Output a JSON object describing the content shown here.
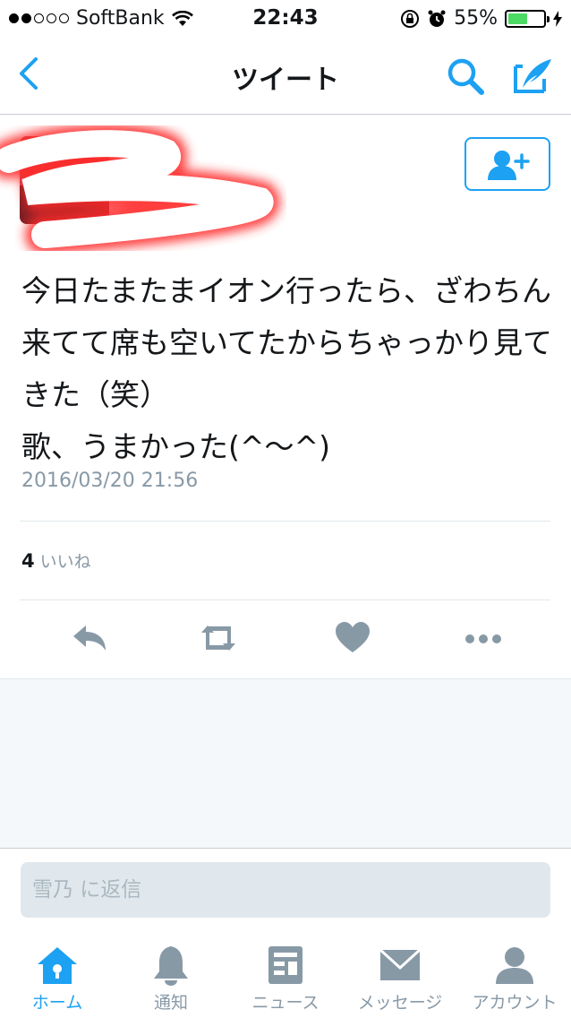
{
  "status_bar": {
    "carrier": "SoftBank",
    "time": "22:43",
    "battery_percent": "55%",
    "battery_level": 0.55,
    "signal_bars_filled": 2,
    "signal_bars_total": 5
  },
  "nav": {
    "title": "ツイート",
    "back_icon": "chevron-left-icon",
    "search_icon": "search-icon",
    "compose_icon": "compose-icon"
  },
  "tweet": {
    "text": "今日たまたまイオン行ったら、ざわちん来てて席も空いてたからちゃっかり見てきた（笑）\n歌、うまかった(^〜^)",
    "timestamp": "2016/03/20 21:56",
    "like_count": "4",
    "like_label": "いいね"
  },
  "actions": [
    "reply-icon",
    "retweet-icon",
    "like-icon",
    "more-icon"
  ],
  "reply": {
    "placeholder": "雪乃 に返信"
  },
  "tabbar": {
    "items": [
      {
        "label": "ホーム",
        "icon": "home-icon"
      },
      {
        "label": "通知",
        "icon": "bell-icon"
      },
      {
        "label": "ニュース",
        "icon": "news-icon"
      },
      {
        "label": "メッセージ",
        "icon": "envelope-icon"
      },
      {
        "label": "アカウント",
        "icon": "person-icon"
      }
    ]
  },
  "colors": {
    "accent": "#1da1f2",
    "icon_gray": "#8899a6",
    "battery_green": "#4cd964"
  }
}
